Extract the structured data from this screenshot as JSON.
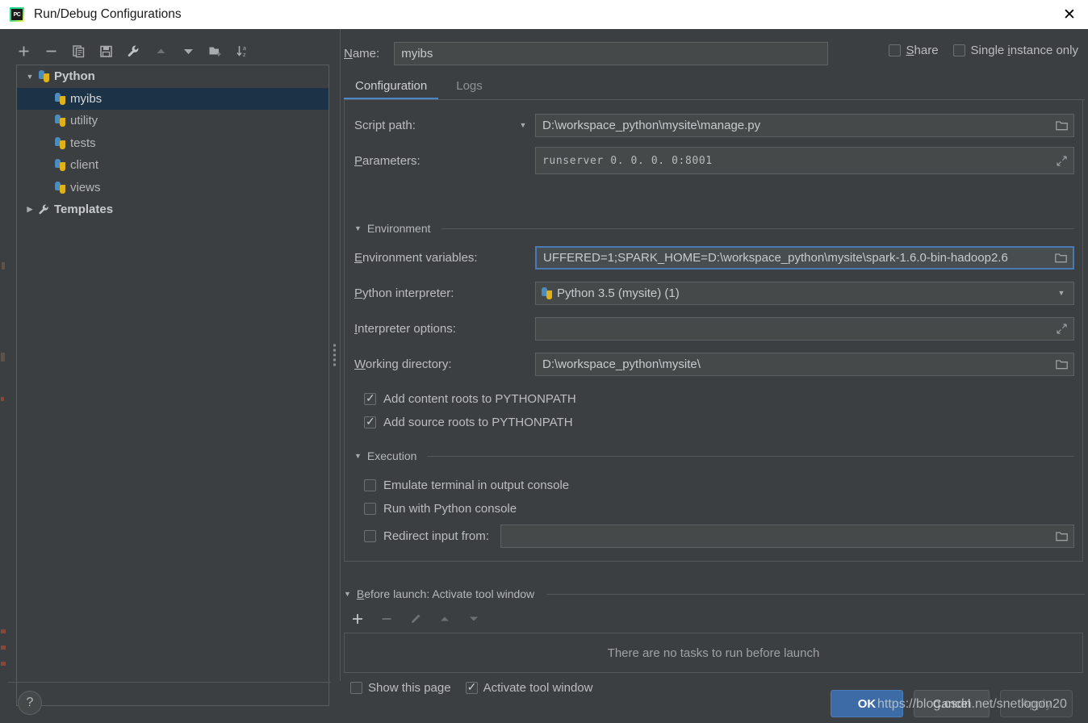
{
  "window": {
    "title": "Run/Debug Configurations",
    "icon": "pycharm-icon",
    "icon_text": "PC",
    "close_label": "✕"
  },
  "tree_toolbar": [
    {
      "name": "add-configuration-button",
      "glyph": "+",
      "dim": false
    },
    {
      "name": "remove-configuration-button",
      "glyph": "−",
      "dim": false
    },
    {
      "name": "copy-configuration-button",
      "glyph": "copy-icon",
      "dim": false
    },
    {
      "name": "save-configuration-button",
      "glyph": "save-icon",
      "dim": false
    },
    {
      "name": "edit-templates-button",
      "glyph": "wrench-icon",
      "dim": false
    },
    {
      "name": "move-up-button",
      "glyph": "▲",
      "dim": true
    },
    {
      "name": "move-down-button",
      "glyph": "▼",
      "dim": false
    },
    {
      "name": "new-folder-button",
      "glyph": "folder-add-icon",
      "dim": false
    },
    {
      "name": "sort-alphabetically-button",
      "glyph": "sort-az-icon",
      "dim": false
    }
  ],
  "tree": {
    "items": [
      {
        "label": "Python",
        "type": "group",
        "expanded": true,
        "twisty": "▼",
        "icon": "python-icon",
        "selected": false
      },
      {
        "label": "myibs",
        "type": "child",
        "icon": "python-icon",
        "selected": true
      },
      {
        "label": "utility",
        "type": "child",
        "icon": "python-icon",
        "selected": false
      },
      {
        "label": "tests",
        "type": "child",
        "icon": "python-icon",
        "selected": false
      },
      {
        "label": "client",
        "type": "child",
        "icon": "python-icon",
        "selected": false
      },
      {
        "label": "views",
        "type": "child",
        "icon": "python-icon",
        "selected": false
      },
      {
        "label": "Templates",
        "type": "group",
        "expanded": false,
        "twisty": "▶",
        "icon": "wrench-icon",
        "selected": false
      }
    ]
  },
  "header": {
    "name_label": "Name:",
    "name_value": "myibs",
    "share_label": "Share",
    "share_checked": false,
    "single_instance_label": "Single instance only",
    "single_instance_checked": false
  },
  "tabs": [
    {
      "label": "Configuration",
      "active": true
    },
    {
      "label": "Logs",
      "active": false
    }
  ],
  "form": {
    "script_path_label": "Script path:",
    "script_path_value": "D:\\workspace_python\\mysite\\manage.py",
    "parameters_label": "Parameters:",
    "parameters_value": "runserver 0. 0. 0. 0:8001",
    "environment_section": "Environment",
    "env_vars_label": "Environment variables:",
    "env_vars_value": "UFFERED=1;SPARK_HOME=D:\\workspace_python\\mysite\\spark-1.6.0-bin-hadoop2.6",
    "interpreter_label": "Python interpreter:",
    "interpreter_value": "Python 3.5 (mysite) (1)",
    "interpreter_options_label": "Interpreter options:",
    "interpreter_options_value": "",
    "working_dir_label": "Working directory:",
    "working_dir_value": "D:\\workspace_python\\mysite\\",
    "add_content_roots_label": "Add content roots to PYTHONPATH",
    "add_content_roots_checked": true,
    "add_source_roots_label": "Add source roots to PYTHONPATH",
    "add_source_roots_checked": true,
    "execution_section": "Execution",
    "emulate_terminal_label": "Emulate terminal in output console",
    "emulate_terminal_checked": false,
    "run_with_console_label": "Run with Python console",
    "run_with_console_checked": false,
    "redirect_input_label": "Redirect input from:",
    "redirect_input_checked": false,
    "redirect_input_value": ""
  },
  "before_launch": {
    "section_label": "Before launch: Activate tool window",
    "toolbar": [
      {
        "name": "add-task-button",
        "glyph": "+",
        "dim": false
      },
      {
        "name": "remove-task-button",
        "glyph": "−",
        "dim": true
      },
      {
        "name": "edit-task-button",
        "glyph": "pencil-icon",
        "dim": true
      },
      {
        "name": "task-move-up-button",
        "glyph": "▲",
        "dim": true
      },
      {
        "name": "task-move-down-button",
        "glyph": "▼",
        "dim": true
      }
    ],
    "empty_text": "There are no tasks to run before launch",
    "show_page_label": "Show this page",
    "show_page_checked": false,
    "activate_window_label": "Activate tool window",
    "activate_window_checked": true
  },
  "footer": {
    "help_label": "?",
    "ok_label": "OK",
    "cancel_label": "Cancel",
    "apply_label": "Apply",
    "watermark": "https://blog.csdn.net/snetlogon20"
  },
  "colors": {
    "accent": "#4a88c7",
    "selection": "#1b3247",
    "primary_button": "#3c6ba5",
    "panel": "#3c3f41",
    "field": "#45494a",
    "focus_border": "#4a7ab5"
  }
}
